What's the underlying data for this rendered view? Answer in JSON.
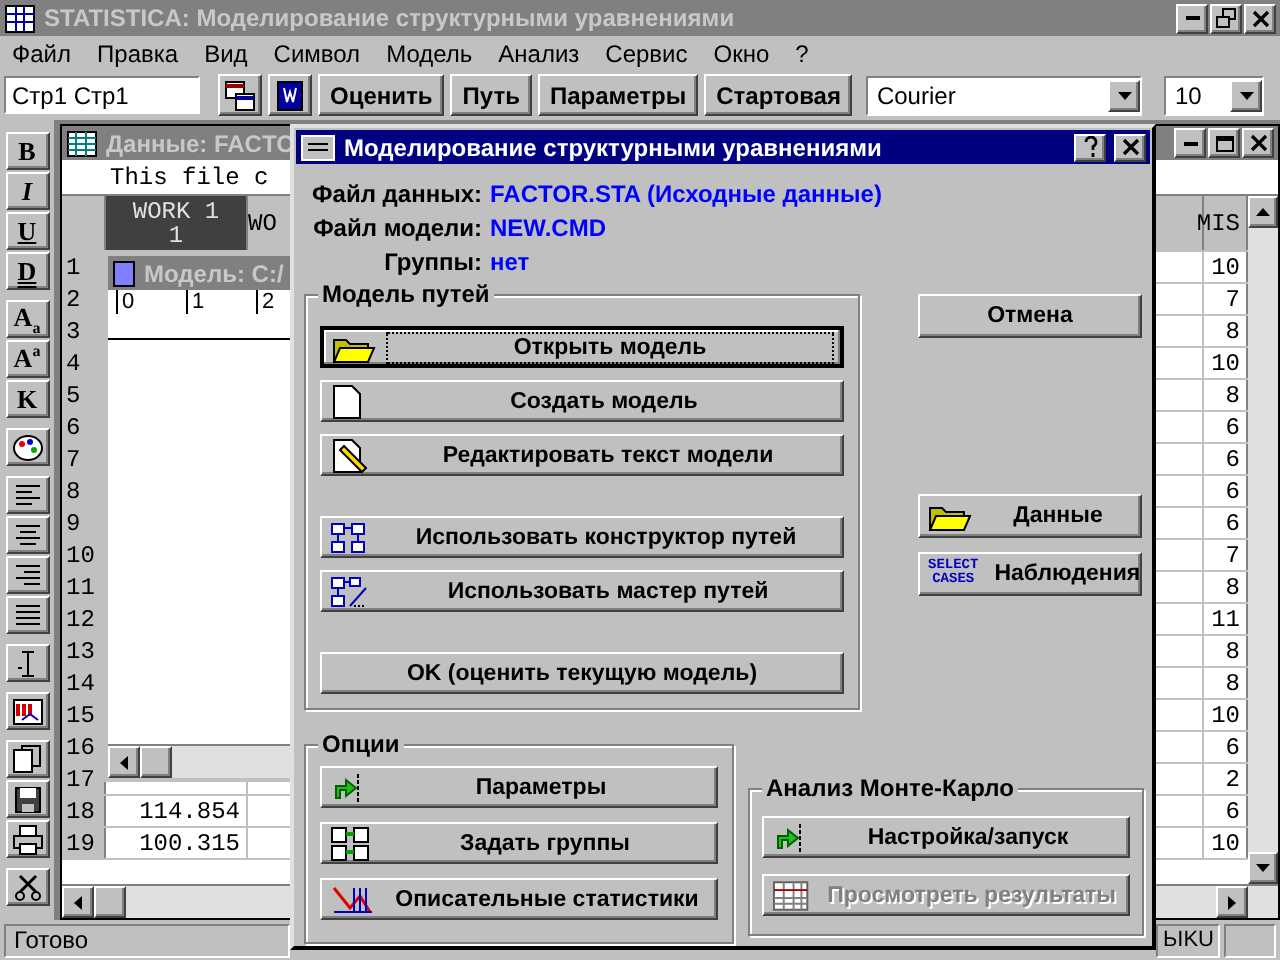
{
  "app": {
    "title": "STATISTICA: Моделирование структурными уравнениями"
  },
  "menu": [
    "Файл",
    "Правка",
    "Вид",
    "Символ",
    "Модель",
    "Анализ",
    "Сервис",
    "Окно",
    "?"
  ],
  "toolbar": {
    "cell_ref": "Стр1 Стр1",
    "buttons": [
      "Оценить",
      "Путь",
      "Параметры",
      "Стартовая"
    ],
    "font": "Courier",
    "font_size": "10"
  },
  "format_bar": [
    "B",
    "I",
    "U",
    "D",
    "A$_{a}$",
    "A$^{a}$",
    "K"
  ],
  "spreadsheet": {
    "title": "Данные: FACTO",
    "note": "This file c",
    "columns": [
      {
        "label": "WORK 1",
        "number": "1",
        "selected": true
      },
      {
        "label": "WO",
        "selected": false
      }
    ],
    "last_column": "MIS",
    "rows": [
      {
        "number": "1",
        "mis": "10"
      },
      {
        "number": "2",
        "mis": "7"
      },
      {
        "number": "3",
        "mis": "8"
      },
      {
        "number": "4",
        "mis": "10"
      },
      {
        "number": "5",
        "mis": "8"
      },
      {
        "number": "6",
        "mis": "6"
      },
      {
        "number": "7",
        "mis": "6"
      },
      {
        "number": "8",
        "mis": "6"
      },
      {
        "number": "9",
        "mis": "6"
      },
      {
        "number": "10",
        "mis": "7"
      },
      {
        "number": "11",
        "mis": "8"
      },
      {
        "number": "12",
        "mis": "11"
      },
      {
        "number": "13",
        "mis": "8"
      },
      {
        "number": "14",
        "mis": "8"
      },
      {
        "number": "15",
        "mis": "10"
      },
      {
        "number": "16",
        "mis": "6"
      },
      {
        "number": "17",
        "mis": "2"
      },
      {
        "number": "18",
        "work_1": "114.854",
        "mis": "6"
      },
      {
        "number": "19",
        "work_1": "100.315",
        "mis": "10"
      }
    ]
  },
  "text_window": {
    "title": "Модель: C:/",
    "ruler": [
      "0",
      "1",
      "2"
    ]
  },
  "status": {
    "text": "Готово",
    "indicator": "ЬIKU"
  },
  "dialog": {
    "title": "Моделирование структурными уравнениями",
    "info": [
      {
        "label": "Файл данных:",
        "value": "FACTOR.STA (Исходные данные)"
      },
      {
        "label": "Файл модели:",
        "value": "NEW.CMD"
      },
      {
        "label": "Группы:",
        "value": "нет"
      }
    ],
    "path_model": {
      "title": "Модель путей",
      "sections": [
        [
          {
            "label": "Открыть модель",
            "default": true
          },
          {
            "label": "Создать модель",
            "default": false
          },
          {
            "label": "Редактировать текст модели",
            "default": false
          }
        ],
        [
          {
            "label": "Использовать конструктор путей",
            "default": false
          },
          {
            "label": "Использовать мастер путей",
            "default": false
          }
        ],
        [
          {
            "label": "OK (оценить текущую модель)",
            "default": false
          }
        ]
      ]
    },
    "side_buttons": [
      {
        "label": "Отмена"
      },
      {
        "label": "Данные"
      },
      {
        "label": "Наблюдения",
        "icon_text": [
          "SELECT",
          "CASES"
        ]
      }
    ],
    "options": {
      "title": "Опции",
      "buttons": [
        {
          "label": "Параметры"
        },
        {
          "label": "Задать группы"
        },
        {
          "label": "Описательные статистики"
        }
      ]
    },
    "monte_carlo": {
      "title": "Анализ Монте-Карло",
      "buttons": [
        {
          "label": "Настройка/запуск",
          "disabled": false
        },
        {
          "label": "Просмотреть результаты",
          "disabled": true
        }
      ]
    }
  }
}
